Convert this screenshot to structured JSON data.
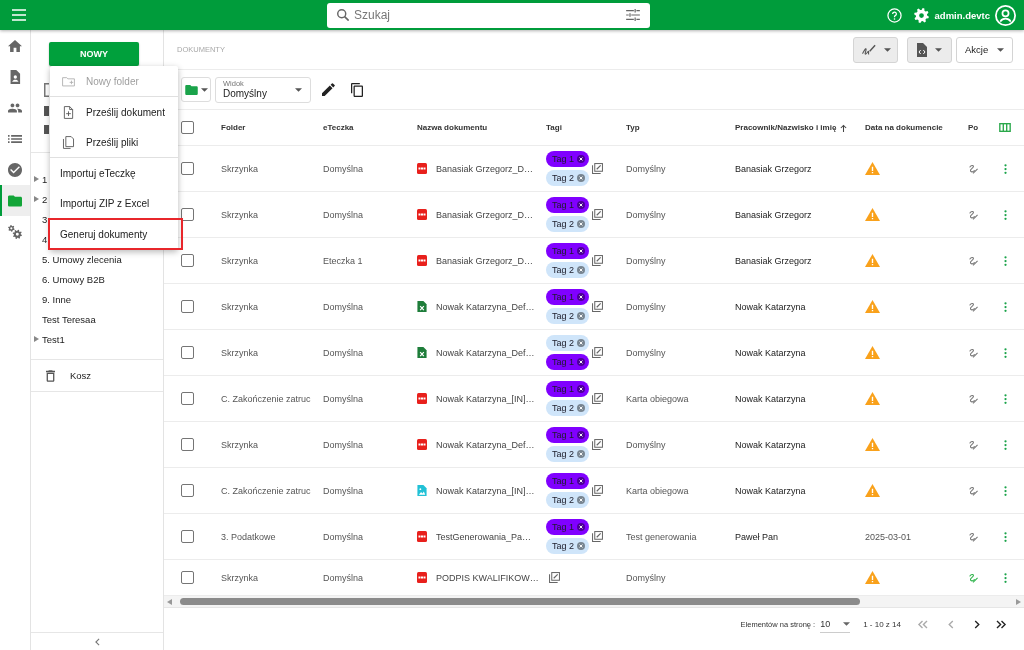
{
  "topbar": {
    "search": {
      "placeholder": "Szukaj"
    },
    "user": "admin.devtc"
  },
  "rail": [
    {
      "kind": "home",
      "selected": false
    },
    {
      "kind": "profile",
      "selected": false
    },
    {
      "kind": "people",
      "selected": false
    },
    {
      "kind": "list",
      "selected": false
    },
    {
      "kind": "tasks",
      "selected": false
    },
    {
      "kind": "folders",
      "selected": true
    },
    {
      "kind": "settings",
      "selected": false
    }
  ],
  "sidebar": {
    "new_button": "NOWY",
    "tree": [
      {
        "label": "1",
        "expandable": true
      },
      {
        "label": "2",
        "expandable": true
      },
      {
        "label": "3",
        "expandable": false
      },
      {
        "label": "4",
        "expandable": false
      },
      {
        "label": "5. Umowy zlecenia",
        "expandable": false
      },
      {
        "label": "6. Umowy B2B",
        "expandable": false
      },
      {
        "label": "9. Inne",
        "expandable": false
      },
      {
        "label": "Test Teresaa",
        "expandable": false
      },
      {
        "label": "Test1",
        "expandable": true
      }
    ],
    "trash": "Kosz"
  },
  "new_menu": {
    "groups": [
      [
        {
          "kind": "new_folder",
          "label": "Nowy folder",
          "disabled": true,
          "highlighted": false
        }
      ],
      [
        {
          "kind": "upload_file",
          "label": "Prześlij dokument",
          "disabled": false,
          "highlighted": false
        },
        {
          "kind": "upload_files",
          "label": "Prześlij pliki",
          "disabled": false,
          "highlighted": false
        }
      ],
      [
        {
          "kind": "plain",
          "label": "Importuj eTeczkę",
          "disabled": false,
          "highlighted": false
        },
        {
          "kind": "plain",
          "label": "Importuj ZIP z Excel",
          "disabled": false,
          "highlighted": false
        },
        {
          "kind": "plain",
          "label": "Generuj dokumenty",
          "disabled": false,
          "highlighted": true
        }
      ]
    ]
  },
  "header": {
    "title": "DOKUMENTY",
    "actions": [
      {
        "kind": "signature"
      },
      {
        "kind": "export"
      },
      {
        "kind": "text",
        "label": "Akcje"
      }
    ]
  },
  "toolbar": {
    "view": {
      "label": "Widok",
      "value": "Domyślny"
    }
  },
  "table": {
    "all_selected": false,
    "columns": [
      {
        "label": "Folder",
        "sorted": false
      },
      {
        "label": "eTeczka",
        "sorted": false
      },
      {
        "label": "Nazwa dokumentu",
        "sorted": false
      },
      {
        "label": "Tagi",
        "sorted": false
      },
      {
        "label": "Typ",
        "sorted": false
      },
      {
        "label": "Pracownik/Nazwisko i imię",
        "sorted": true
      },
      {
        "label": "Data na dokumencie",
        "sorted": false
      },
      {
        "label": "Po",
        "sorted": false
      }
    ],
    "rows": [
      {
        "kind": "pdf",
        "selected": false,
        "folder": "Skrzynka",
        "eteczka": "Domyślna",
        "name": "Banasiak Grzegorz_D…",
        "tags": [
          {
            "label": "Tag 1",
            "color": "#8000ff"
          },
          {
            "label": "Tag 2",
            "color": "#cfe5fa"
          }
        ],
        "type": "Domyślny",
        "employee": "Banasiak Grzegorz",
        "date_warning": true,
        "signed": false
      },
      {
        "kind": "pdf",
        "selected": false,
        "folder": "Skrzynka",
        "eteczka": "Domyślna",
        "name": "Banasiak Grzegorz_D…",
        "tags": [
          {
            "label": "Tag 1",
            "color": "#8000ff"
          },
          {
            "label": "Tag 2",
            "color": "#cfe5fa"
          }
        ],
        "type": "Domyślny",
        "employee": "Banasiak Grzegorz",
        "date_warning": true,
        "signed": false
      },
      {
        "kind": "pdf",
        "selected": false,
        "folder": "Skrzynka",
        "eteczka": "Eteczka 1",
        "name": "Banasiak Grzegorz_D…",
        "tags": [
          {
            "label": "Tag 1",
            "color": "#8000ff"
          },
          {
            "label": "Tag 2",
            "color": "#cfe5fa"
          }
        ],
        "type": "Domyślny",
        "employee": "Banasiak Grzegorz",
        "date_warning": true,
        "signed": false
      },
      {
        "kind": "spreadsheet",
        "selected": false,
        "folder": "Skrzynka",
        "eteczka": "Domyślna",
        "name": "Nowak Katarzyna_Def…",
        "tags": [
          {
            "label": "Tag 1",
            "color": "#8000ff"
          },
          {
            "label": "Tag 2",
            "color": "#cfe5fa"
          }
        ],
        "type": "Domyślny",
        "employee": "Nowak Katarzyna",
        "date_warning": true,
        "signed": false
      },
      {
        "kind": "spreadsheet",
        "selected": false,
        "folder": "Skrzynka",
        "eteczka": "Domyślna",
        "name": "Nowak Katarzyna_Def…",
        "tags": [
          {
            "label": "Tag 2",
            "color": "#cfe5fa"
          },
          {
            "label": "Tag 1",
            "color": "#8000ff"
          }
        ],
        "type": "Domyślny",
        "employee": "Nowak Katarzyna",
        "date_warning": true,
        "signed": false
      },
      {
        "kind": "pdf",
        "selected": false,
        "folder": "C. Zakończenie zatruc",
        "eteczka": "Domyślna",
        "name": "Nowak Katarzyna_[IN]…",
        "tags": [
          {
            "label": "Tag 1",
            "color": "#8000ff"
          },
          {
            "label": "Tag 2",
            "color": "#cfe5fa"
          }
        ],
        "type": "Karta obiegowa",
        "employee": "Nowak Katarzyna",
        "date_warning": true,
        "signed": false
      },
      {
        "kind": "pdf",
        "selected": false,
        "folder": "Skrzynka",
        "eteczka": "Domyślna",
        "name": "Nowak Katarzyna_Def…",
        "tags": [
          {
            "label": "Tag 1",
            "color": "#8000ff"
          },
          {
            "label": "Tag 2",
            "color": "#cfe5fa"
          }
        ],
        "type": "Domyślny",
        "employee": "Nowak Katarzyna",
        "date_warning": true,
        "signed": false
      },
      {
        "kind": "image",
        "selected": false,
        "folder": "C. Zakończenie zatruc",
        "eteczka": "Domyślna",
        "name": "Nowak Katarzyna_[IN]…",
        "tags": [
          {
            "label": "Tag 1",
            "color": "#8000ff"
          },
          {
            "label": "Tag 2",
            "color": "#cfe5fa"
          }
        ],
        "type": "Karta obiegowa",
        "employee": "Nowak Katarzyna",
        "date_warning": true,
        "signed": false
      },
      {
        "kind": "pdf",
        "selected": false,
        "folder": "3. Podatkowe",
        "eteczka": "Domyślna",
        "name": "TestGenerowania_Pa…",
        "tags": [
          {
            "label": "Tag 1",
            "color": "#8000ff"
          },
          {
            "label": "Tag 2",
            "color": "#cfe5fa"
          }
        ],
        "type": "Test generowania",
        "employee": "Paweł Pan",
        "date": "2025-03-01",
        "date_warning": false,
        "signed": false
      },
      {
        "kind": "pdf",
        "selected": false,
        "folder": "Skrzynka",
        "eteczka": "Domyślna",
        "name": "PODPIS KWALIFIKOW…",
        "type": "Domyślny",
        "date_warning": true,
        "signed": true
      }
    ]
  },
  "pagination": {
    "page_size_label": "Elementów na stronę :",
    "page_size": "10",
    "range": "1 - 10 z 14",
    "buttons": [
      {
        "kind": "first",
        "disabled": true
      },
      {
        "kind": "prev",
        "disabled": true
      },
      {
        "kind": "next",
        "disabled": false
      },
      {
        "kind": "last",
        "disabled": false
      }
    ]
  }
}
